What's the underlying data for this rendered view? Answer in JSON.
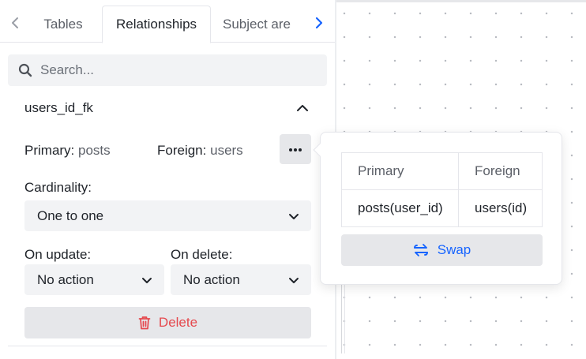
{
  "tabs": {
    "items": [
      {
        "label": "Tables"
      },
      {
        "label": "Relationships"
      },
      {
        "label": "Subject are"
      }
    ]
  },
  "search": {
    "placeholder": "Search..."
  },
  "relationship": {
    "name": "users_id_fk",
    "primary_key_label": "Primary:",
    "primary_value": "posts",
    "foreign_key_label": "Foreign:",
    "foreign_value": "users",
    "cardinality_label": "Cardinality:",
    "cardinality_value": "One to one",
    "on_update_label": "On update:",
    "on_update_value": "No action",
    "on_delete_label": "On delete:",
    "on_delete_value": "No action",
    "delete_label": "Delete"
  },
  "popover": {
    "headers": [
      "Primary",
      "Foreign"
    ],
    "row": [
      "posts(user_id)",
      "users(id)"
    ],
    "swap_label": "Swap"
  },
  "colors": {
    "accent": "#1664ff",
    "danger": "#e5484d",
    "button_bg": "#e6e7ea",
    "input_bg": "#f2f3f5"
  },
  "icons": {
    "search": "search-icon",
    "collapse": "chevron-up-icon",
    "more": "more-horizontal-icon",
    "select": "chevron-down-icon",
    "delete": "trash-icon",
    "swap": "swap-icon",
    "tab_prev": "chevron-left-icon",
    "tab_next": "chevron-right-icon"
  }
}
